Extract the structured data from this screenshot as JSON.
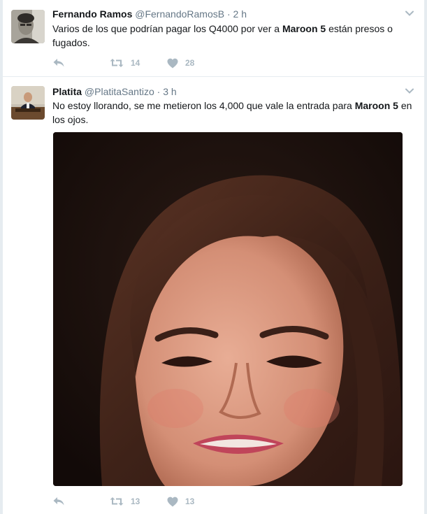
{
  "tweets": [
    {
      "fullname": "Fernando Ramos",
      "username": "@FernandoRamosB",
      "separator": "·",
      "time": "2 h",
      "text_before": "Varios de los que podrían pagar los Q4000 por ver a ",
      "text_bold": "Maroon 5",
      "text_after": " están presos o fugados.",
      "retweets": "14",
      "likes": "28"
    },
    {
      "fullname": "Platita",
      "username": "@PlatitaSantizo",
      "separator": "·",
      "time": "3 h",
      "text_before": "No estoy llorando, se me metieron los 4,000 que vale la entrada para ",
      "text_bold": "Maroon 5",
      "text_after": " en los ojos.",
      "retweets": "13",
      "likes": "13"
    }
  ],
  "icons": {
    "reply": "reply-icon",
    "retweet": "retweet-icon",
    "like": "heart-icon",
    "caret": "chevron-down-icon"
  },
  "colors": {
    "action_gray": "#aab8c2",
    "secondary_text": "#657786",
    "divider": "#e6ecf0"
  }
}
